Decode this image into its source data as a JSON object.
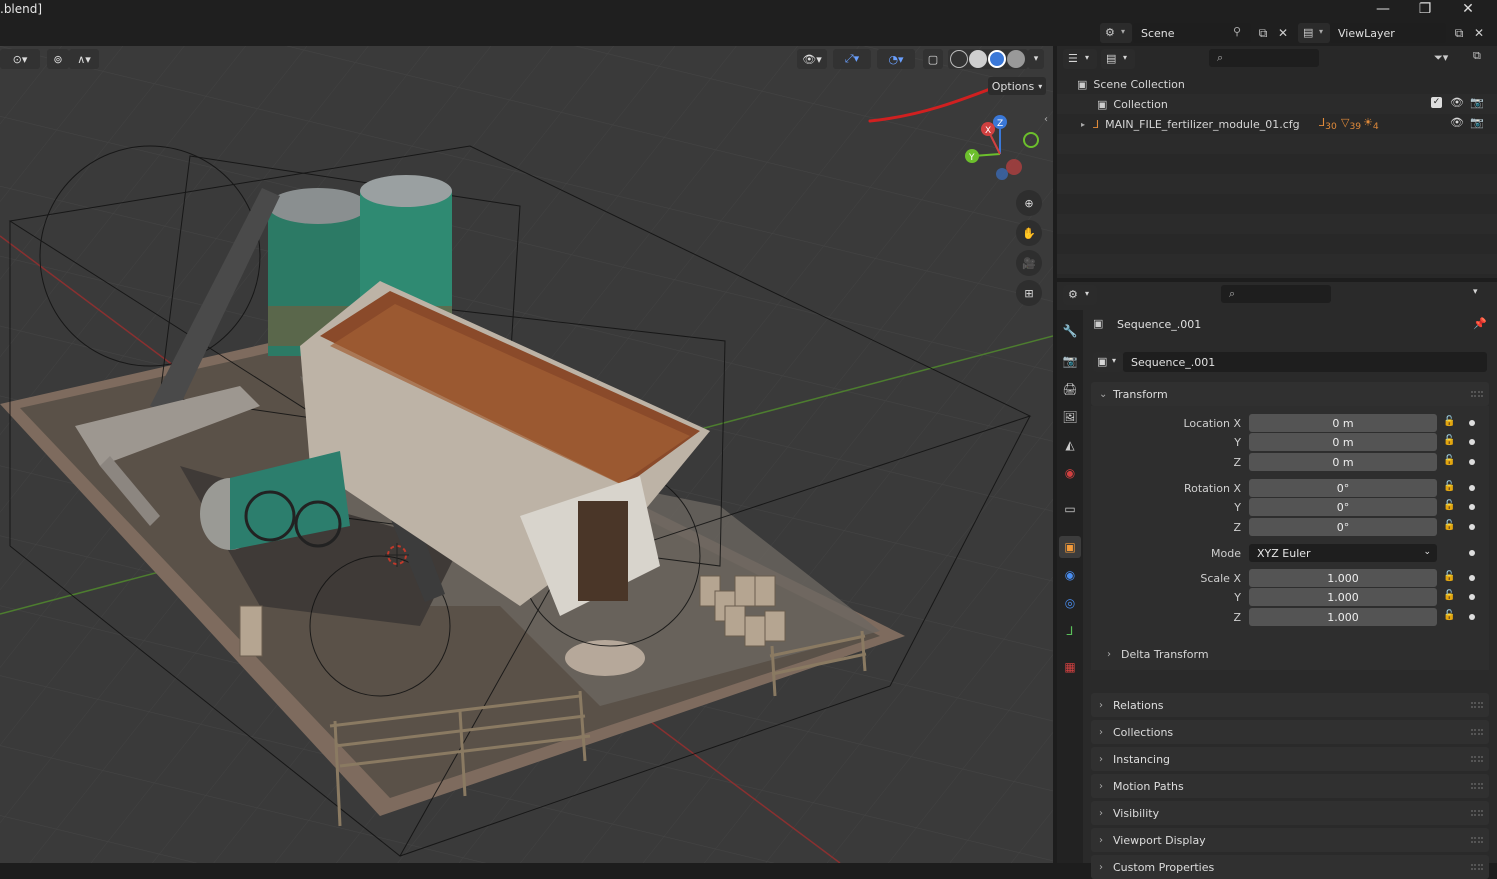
{
  "window": {
    "title": ".blend]",
    "minimize": "—",
    "maximize": "❐",
    "close": "✕"
  },
  "scene": {
    "label": "Scene",
    "viewlayer_label": "ViewLayer"
  },
  "viewport": {
    "options_label": "Options",
    "accent_arrow_color": "#d02020"
  },
  "outliner": {
    "search_placeholder": "",
    "rows": [
      {
        "label": "Scene Collection"
      },
      {
        "label": "Collection"
      },
      {
        "label": "MAIN_FILE_fertilizer_module_01.cfg",
        "count_a": "30",
        "count_b": "39",
        "count_c": "4"
      }
    ]
  },
  "properties": {
    "search_placeholder": "",
    "object_name": "Sequence_.001",
    "object_field": "Sequence_.001",
    "transform": {
      "header": "Transform",
      "location": {
        "x_label": "Location X",
        "y_label": "Y",
        "z_label": "Z",
        "x": "0 m",
        "y": "0 m",
        "z": "0 m"
      },
      "rotation": {
        "x_label": "Rotation X",
        "y_label": "Y",
        "z_label": "Z",
        "x": "0°",
        "y": "0°",
        "z": "0°"
      },
      "mode_label": "Mode",
      "mode_value": "XYZ Euler",
      "scale": {
        "x_label": "Scale X",
        "y_label": "Y",
        "z_label": "Z",
        "x": "1.000",
        "y": "1.000",
        "z": "1.000"
      },
      "delta_label": "Delta Transform"
    },
    "sections": [
      "Relations",
      "Collections",
      "Instancing",
      "Motion Paths",
      "Visibility",
      "Viewport Display",
      "Custom Properties"
    ]
  },
  "gizmo": {
    "x": "X",
    "y": "Y",
    "z": "Z"
  }
}
